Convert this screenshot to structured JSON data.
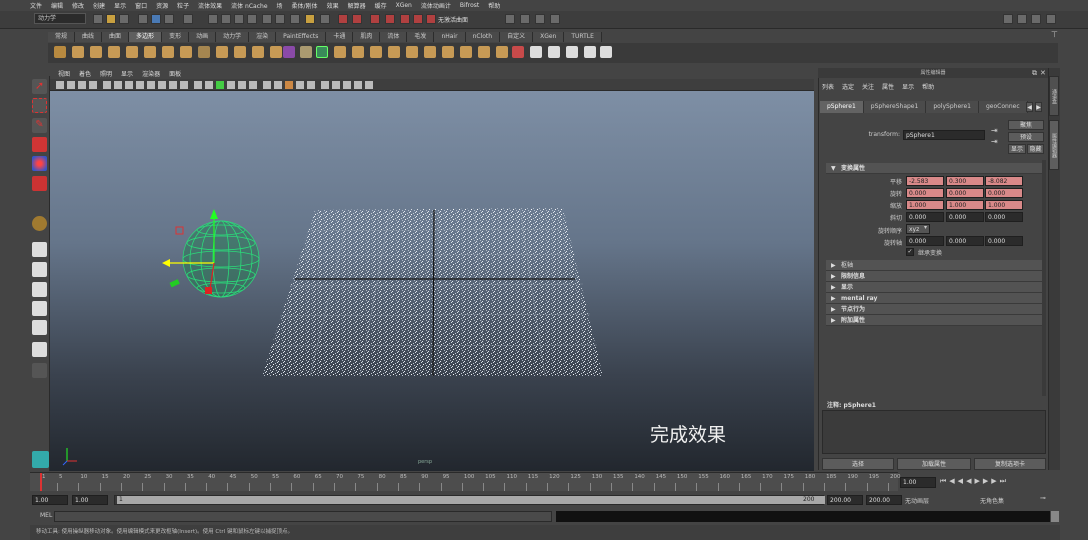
{
  "menubar": {
    "items": [
      "文件",
      "编辑",
      "修改",
      "创建",
      "显示",
      "窗口",
      "资源",
      "粒子",
      "流体效果",
      "流体 nCache",
      "场",
      "柔体/刚体",
      "效果",
      "解算器",
      "缓存",
      "XGen",
      "流体动画计",
      "Bifrost",
      "帮助"
    ]
  },
  "statusline": {
    "mode": "动力学",
    "render_label": "无激活曲面"
  },
  "shelf": {
    "tabs": [
      "常规",
      "曲线",
      "曲面",
      "多边形",
      "变形",
      "动画",
      "动力学",
      "渲染",
      "PaintEffects",
      "卡通",
      "肌肉",
      "流体",
      "毛发",
      "nHair",
      "nCloth",
      "自定义",
      "XGen",
      "TURTLE"
    ],
    "active": "多边形"
  },
  "viewport": {
    "menu": [
      "视图",
      "着色",
      "照明",
      "显示",
      "渲染器",
      "面板"
    ],
    "caption": "完成效果",
    "camera_label": "persp"
  },
  "attribute_editor": {
    "title": "属性编辑器",
    "menu": [
      "列表",
      "选定",
      "关注",
      "属性",
      "显示",
      "帮助"
    ],
    "tabs": [
      "pSphere1",
      "pSphereShape1",
      "polySphere1",
      "geoConnec"
    ],
    "active_tab": "pSphere1",
    "transform_label": "transform:",
    "transform_value": "pSphere1",
    "focus_btn": "聚焦",
    "presets_btn": "预设",
    "show_btn": "显示",
    "hide_btn": "隐藏",
    "section_transform": "变换属性",
    "rows": [
      {
        "label": "平移",
        "values": [
          "-2.583",
          "0.300",
          "-8.082"
        ],
        "keyed": true
      },
      {
        "label": "旋转",
        "values": [
          "0.000",
          "0.000",
          "0.000"
        ],
        "keyed": true
      },
      {
        "label": "缩放",
        "values": [
          "1.000",
          "1.000",
          "1.000"
        ],
        "keyed": true
      },
      {
        "label": "斜切",
        "values": [
          "0.000",
          "0.000",
          "0.000"
        ],
        "keyed": false
      }
    ],
    "rotate_order_label": "旋转顺序",
    "rotate_order_value": "xyz",
    "rotate_axis_label": "旋转轴",
    "rotate_axis_values": [
      "0.000",
      "0.000",
      "0.000"
    ],
    "inherit_label": "继承变换",
    "sections": [
      "枢轴",
      "限制信息",
      "显示",
      "mental ray",
      "节点行为",
      "附加属性"
    ],
    "notes_label": "注释: pSphere1",
    "bottom_buttons": [
      "选择",
      "加载属性",
      "复制选项卡"
    ]
  },
  "timeline": {
    "ticks": [
      1,
      5,
      10,
      15,
      20,
      25,
      30,
      35,
      40,
      45,
      50,
      55,
      60,
      65,
      70,
      75,
      80,
      85,
      90,
      95,
      100,
      105,
      110,
      115,
      120,
      125,
      130,
      135,
      140,
      145,
      150,
      155,
      160,
      165,
      170,
      175,
      180,
      185,
      190,
      195,
      200
    ],
    "current": "1.00"
  },
  "range": {
    "start": "1.00",
    "playback_start": "1.00",
    "slider_start": "1",
    "slider_end": "200",
    "playback_end": "200.00",
    "end": "200.00",
    "anim_layer": "无动画层",
    "char_set": "无角色集"
  },
  "cmdline": {
    "label": "MEL"
  },
  "helpline": {
    "text": "移动工具: 使用操纵器移动对象。使用编辑模式来更改枢轴(Insert)。使用 Ctrl 键和鼠标左键以捕捉顶点。"
  },
  "colors": {
    "keyed": "#d98989",
    "wire": "#2bdc7a",
    "bg": "#444444"
  }
}
